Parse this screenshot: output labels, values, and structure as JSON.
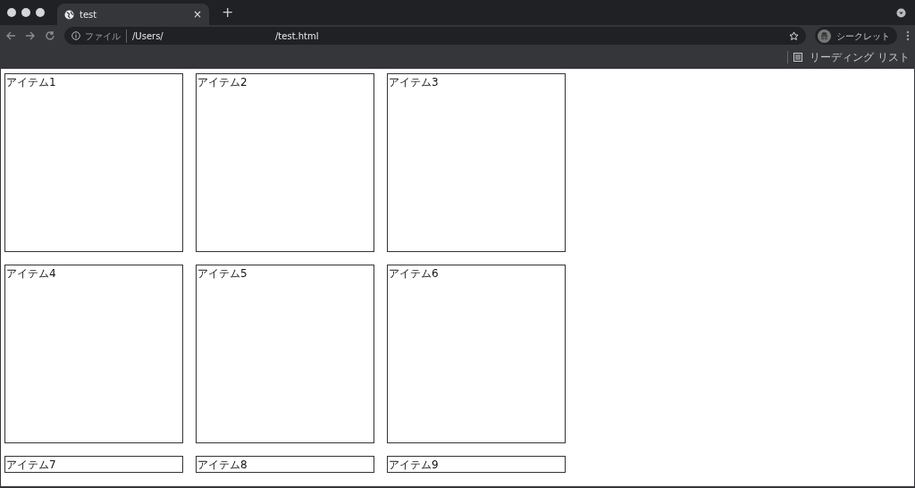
{
  "window": {
    "tab_title": "test",
    "tab_close": "×",
    "new_tab": "+"
  },
  "toolbar": {
    "url_scheme": "ファイル",
    "url_start": "/Users/",
    "url_end": "/test.html",
    "profile": "シークレット"
  },
  "bookmarks_bar": {
    "reading_list": "リーディング リスト"
  },
  "items": [
    {
      "label": "アイテム1",
      "kind": "square"
    },
    {
      "label": "アイテム2",
      "kind": "square"
    },
    {
      "label": "アイテム3",
      "kind": "square"
    },
    {
      "label": "アイテム4",
      "kind": "square"
    },
    {
      "label": "アイテム5",
      "kind": "square"
    },
    {
      "label": "アイテム6",
      "kind": "square"
    },
    {
      "label": "アイテム7",
      "kind": "strip"
    },
    {
      "label": "アイテム8",
      "kind": "strip"
    },
    {
      "label": "アイテム9",
      "kind": "strip"
    }
  ]
}
